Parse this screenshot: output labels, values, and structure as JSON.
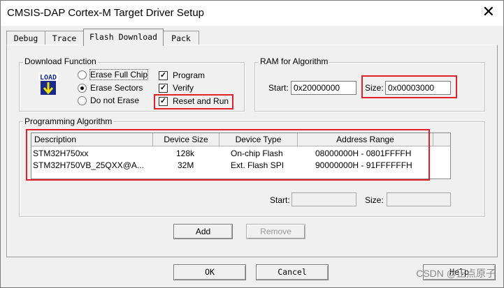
{
  "window": {
    "title": "CMSIS-DAP Cortex-M Target Driver Setup"
  },
  "tabs": [
    {
      "label": "Debug"
    },
    {
      "label": "Trace"
    },
    {
      "label": "Flash Download"
    },
    {
      "label": "Pack"
    }
  ],
  "download_function": {
    "group_label": "Download Function",
    "icon_text": "LOAD",
    "radios": [
      {
        "label": "Erase Full Chip",
        "selected": false
      },
      {
        "label": "Erase Sectors",
        "selected": true
      },
      {
        "label": "Do not Erase",
        "selected": false
      }
    ],
    "checks": [
      {
        "label": "Program",
        "checked": true
      },
      {
        "label": "Verify",
        "checked": true
      },
      {
        "label": "Reset and Run",
        "checked": true
      }
    ]
  },
  "ram": {
    "group_label": "RAM for Algorithm",
    "start_label": "Start:",
    "start_value": "0x20000000",
    "size_label": "Size:",
    "size_value": "0x00003000"
  },
  "programming": {
    "group_label": "Programming Algorithm",
    "columns": [
      "Description",
      "Device Size",
      "Device Type",
      "Address Range"
    ],
    "rows": [
      {
        "description": "STM32H750xx",
        "size": "128k",
        "type": "On-chip Flash",
        "range": "08000000H - 0801FFFFH"
      },
      {
        "description": "STM32H750VB_25QXX@A...",
        "size": "32M",
        "type": "Ext. Flash SPI",
        "range": "90000000H - 91FFFFFFH"
      }
    ],
    "start_label": "Start:",
    "start_value": "",
    "size_label": "Size:",
    "size_value": "",
    "add_label": "Add",
    "remove_label": "Remove"
  },
  "buttons": {
    "ok": "OK",
    "cancel": "Cancel",
    "help": "Help"
  },
  "watermark": "CSDN @正点原子",
  "colors": {
    "highlight": "#e0202a"
  }
}
